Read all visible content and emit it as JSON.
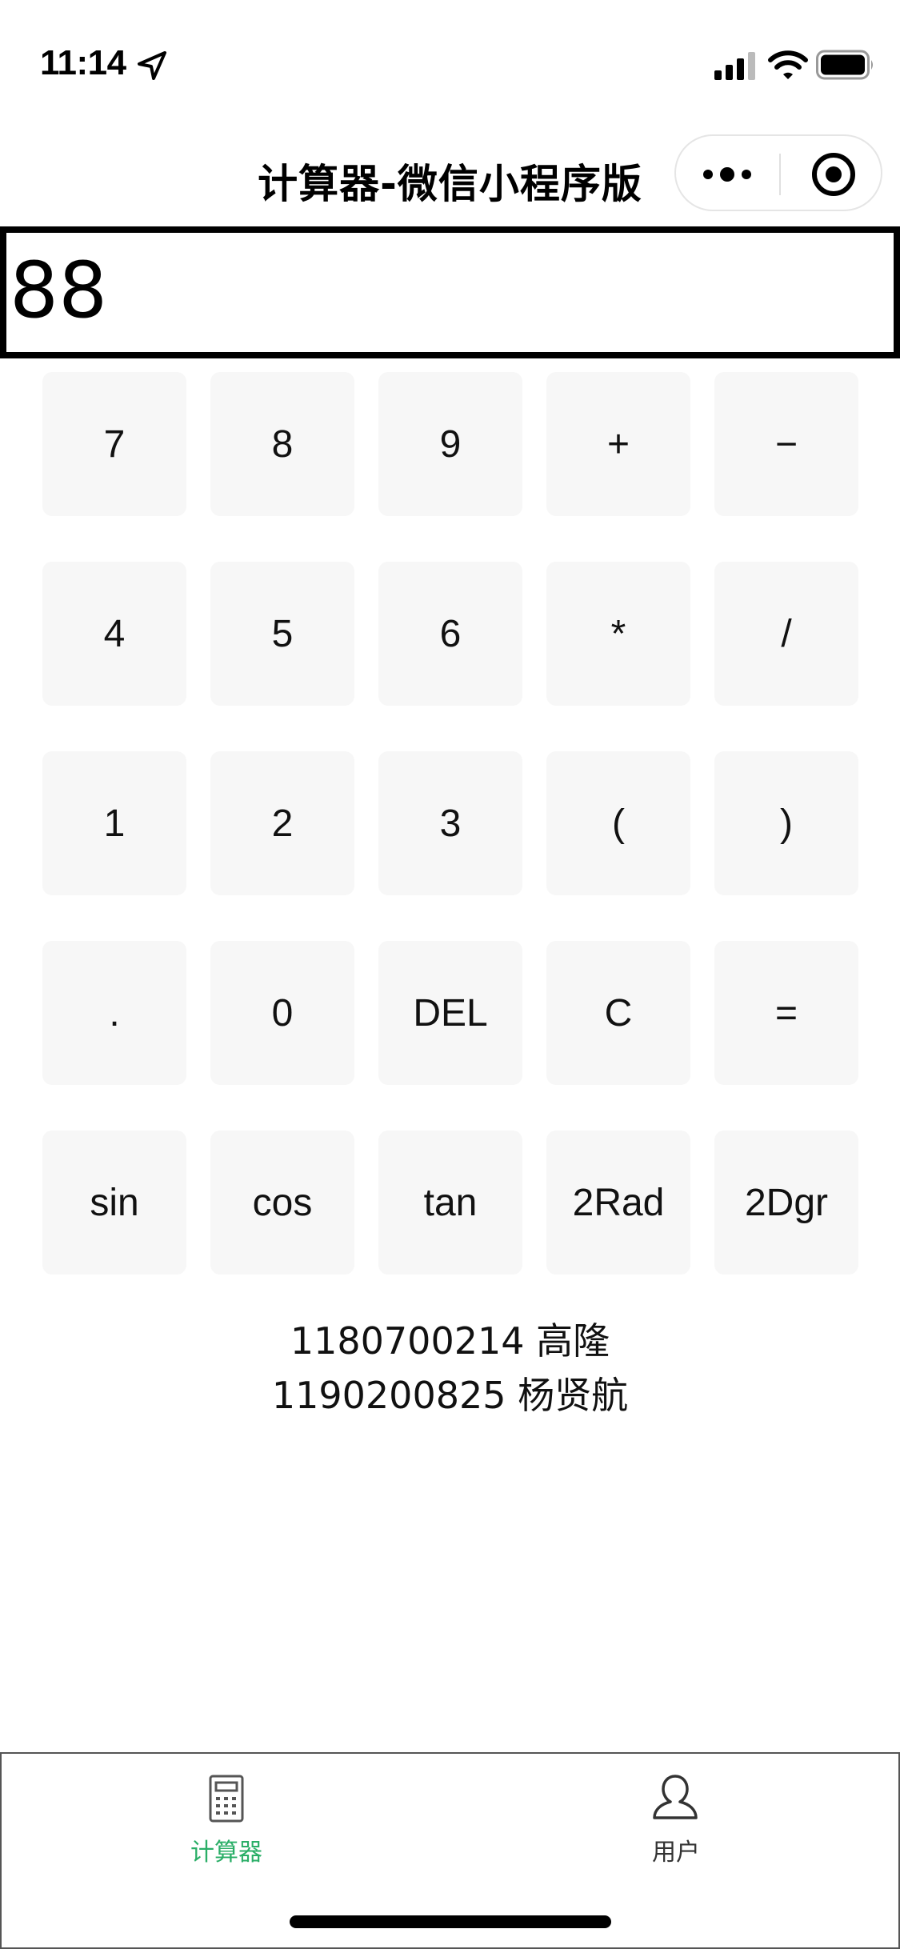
{
  "status_bar": {
    "time": "11:14",
    "icons": [
      "location-arrow-icon",
      "signal-icon",
      "wifi-icon",
      "battery-icon"
    ]
  },
  "nav": {
    "title": "计算器-微信小程序版",
    "icons": [
      "more-icon",
      "close-target-icon"
    ]
  },
  "display": {
    "value": "88"
  },
  "keys": [
    [
      "7",
      "8",
      "9",
      "+",
      "−"
    ],
    [
      "4",
      "5",
      "6",
      "*",
      "/"
    ],
    [
      "1",
      "2",
      "3",
      "(",
      ")"
    ],
    [
      ".",
      "0",
      "DEL",
      "C",
      "="
    ],
    [
      "sin",
      "cos",
      "tan",
      "2Rad",
      "2Dgr"
    ]
  ],
  "credits": [
    "1180700214 高隆",
    "1190200825 杨贤航"
  ],
  "tabbar": {
    "tabs": [
      {
        "label": "计算器",
        "icon": "calculator-icon",
        "active": true,
        "color": "#2aae67"
      },
      {
        "label": "用户",
        "icon": "user-icon",
        "active": false,
        "color": "#333333"
      }
    ]
  },
  "colors": {
    "accent": "#2aae67",
    "key_bg": "#f7f7f7"
  }
}
